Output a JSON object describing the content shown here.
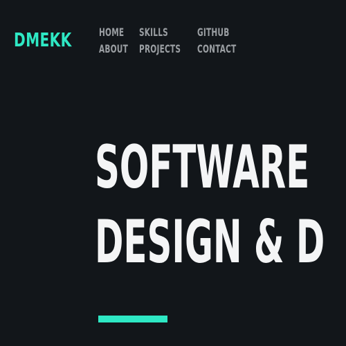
{
  "brand": {
    "logo_text": "DMEKK"
  },
  "nav": {
    "items": [
      {
        "label": "HOME"
      },
      {
        "label": "ABOUT"
      },
      {
        "label": "SKILLS"
      },
      {
        "label": "PROJECTS"
      },
      {
        "label": "GITHUB"
      },
      {
        "label": "CONTACT"
      }
    ]
  },
  "hero": {
    "line1": "SOFTWARE",
    "line2": "DESIGN & D"
  },
  "colors": {
    "background": "#12161a",
    "accent": "#2ee8c4",
    "nav_text": "#9a9ea2",
    "hero_text": "#f4f5f6"
  }
}
